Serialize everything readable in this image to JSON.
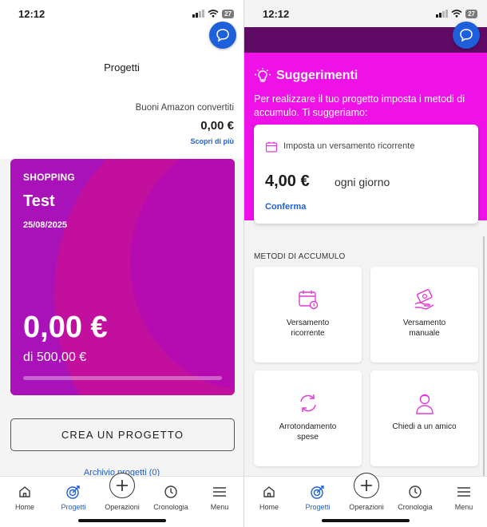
{
  "left": {
    "status": {
      "time": "12:12",
      "battery": "27"
    },
    "header": {
      "title": "Progetti",
      "amazon_label": "Buoni Amazon convertiti",
      "amazon_value": "0,00 €",
      "discover_link": "Scopri di più"
    },
    "project_card": {
      "category": "SHOPPING",
      "name": "Test",
      "date": "25/08/2025",
      "amount": "0,00 €",
      "target": "di 500,00 €",
      "progress_fraction": 0
    },
    "create_button": "CREA UN PROGETTO",
    "archive_link": "Archivio progetti (0)"
  },
  "right": {
    "status": {
      "time": "12:12",
      "battery": "27"
    },
    "suggestions": {
      "title": "Suggerimenti",
      "description": "Per realizzare il tuo progetto imposta i metodi di accumulo. Ti suggeriamo:",
      "card": {
        "text": "Imposta un versamento ricorrente",
        "amount": "4,00 €",
        "frequency": "ogni giorno",
        "confirm": "Conferma"
      }
    },
    "methods": {
      "title": "METODI DI ACCUMULO",
      "items": [
        {
          "label": "Versamento ricorrente",
          "icon": "calendar-clock-icon"
        },
        {
          "label": "Versamento manuale",
          "icon": "money-hand-icon"
        },
        {
          "label": "Arrotondamento spese",
          "icon": "refresh-arrows-icon"
        },
        {
          "label": "Chiedi a un amico",
          "icon": "person-icon"
        }
      ]
    }
  },
  "nav": {
    "items": [
      {
        "label": "Home",
        "icon": "home-icon"
      },
      {
        "label": "Progetti",
        "icon": "target-icon"
      },
      {
        "label": "Operazioni",
        "icon": "plus-icon"
      },
      {
        "label": "Cronologia",
        "icon": "clock-icon"
      },
      {
        "label": "Menu",
        "icon": "menu-icon"
      }
    ],
    "active": "Progetti"
  },
  "colors": {
    "accent_blue": "#1e5fdc",
    "card_purple": "#a812b8",
    "suggest_magenta": "#ee11e8",
    "dark_purple": "#5f0a64"
  }
}
